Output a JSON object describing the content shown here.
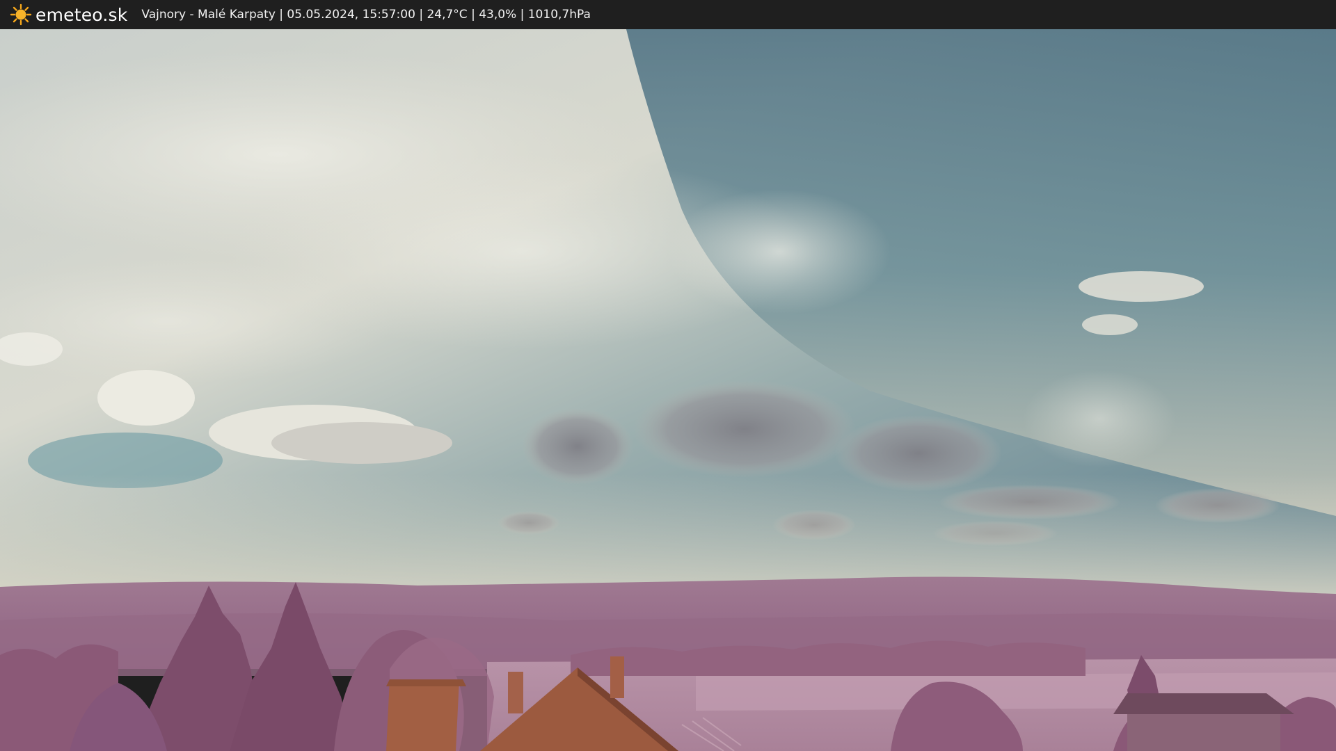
{
  "header": {
    "brand": "emeteo.sk",
    "brand_icon": "sun-icon",
    "caption": "Vajnory - Malé Karpaty | 05.05.2024, 15:57:00 | 24,7°C | 43,0% | 1010,7hPa"
  },
  "webcam": {
    "icon": "webcam-image",
    "colors": {
      "sky_top": "#4f7385",
      "sky_bright": "#dcdcd0",
      "cloud_grey": "#8a8a8f",
      "hills": "#9c6f8a",
      "foliage": "#8c5a78",
      "roof": "#a06244"
    }
  }
}
